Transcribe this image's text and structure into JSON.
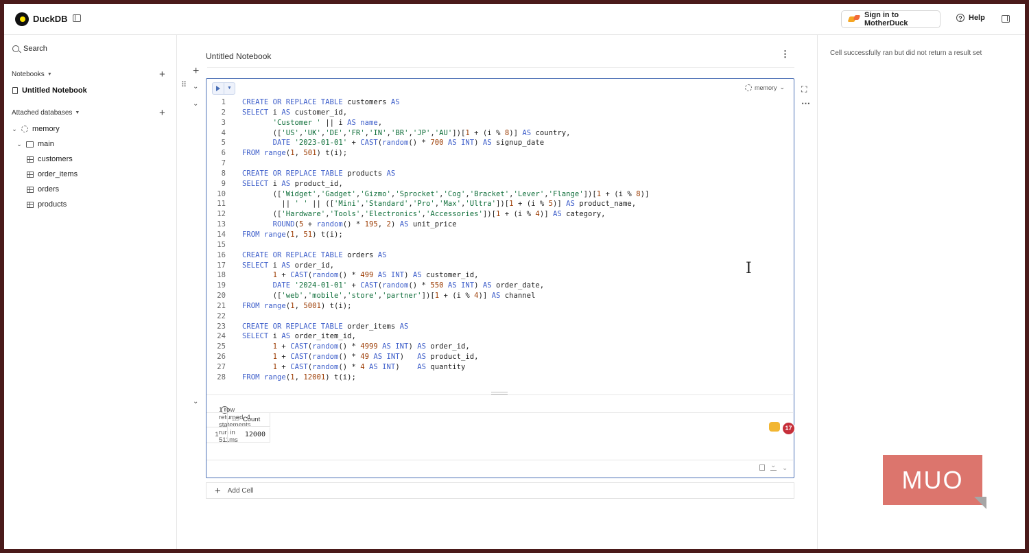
{
  "app": {
    "name": "DuckDB",
    "signin": "Sign in to MotherDuck",
    "help": "Help"
  },
  "sidebar": {
    "search": "Search",
    "notebooks_header": "Notebooks",
    "notebook": "Untitled Notebook",
    "attached_header": "Attached databases",
    "database": "memory",
    "schema": "main",
    "tables": [
      "customers",
      "order_items",
      "orders",
      "products"
    ]
  },
  "notebook": {
    "title": "Untitled Notebook",
    "db_selector": "memory",
    "lines": [
      [
        [
          "kw",
          "CREATE OR REPLACE TABLE "
        ],
        [
          "tx",
          "customers "
        ],
        [
          "kw",
          "AS"
        ]
      ],
      [
        [
          "kw",
          "SELECT "
        ],
        [
          "tx",
          "i "
        ],
        [
          "kw",
          "AS "
        ],
        [
          "tx",
          "customer_id,"
        ]
      ],
      [
        [
          "tx",
          "       "
        ],
        [
          "str",
          "'Customer '"
        ],
        [
          "tx",
          " || i "
        ],
        [
          "kw",
          "AS "
        ],
        [
          "kw",
          "name"
        ],
        [
          "tx",
          ","
        ]
      ],
      [
        [
          "tx",
          "       (["
        ],
        [
          "str",
          "'US'"
        ],
        [
          "tx",
          ","
        ],
        [
          "str",
          "'UK'"
        ],
        [
          "tx",
          ","
        ],
        [
          "str",
          "'DE'"
        ],
        [
          "tx",
          ","
        ],
        [
          "str",
          "'FR'"
        ],
        [
          "tx",
          ","
        ],
        [
          "str",
          "'IN'"
        ],
        [
          "tx",
          ","
        ],
        [
          "str",
          "'BR'"
        ],
        [
          "tx",
          ","
        ],
        [
          "str",
          "'JP'"
        ],
        [
          "tx",
          ","
        ],
        [
          "str",
          "'AU'"
        ],
        [
          "tx",
          "])["
        ],
        [
          "num",
          "1"
        ],
        [
          "tx",
          " + (i % "
        ],
        [
          "num",
          "8"
        ],
        [
          "tx",
          ")] "
        ],
        [
          "kw",
          "AS "
        ],
        [
          "tx",
          "country,"
        ]
      ],
      [
        [
          "tx",
          "       "
        ],
        [
          "kw",
          "DATE "
        ],
        [
          "str",
          "'2023-01-01'"
        ],
        [
          "tx",
          " + "
        ],
        [
          "kw",
          "CAST"
        ],
        [
          "tx",
          "("
        ],
        [
          "kw",
          "random"
        ],
        [
          "tx",
          "() * "
        ],
        [
          "num",
          "700"
        ],
        [
          "tx",
          " "
        ],
        [
          "kw",
          "AS INT"
        ],
        [
          "tx",
          ") "
        ],
        [
          "kw",
          "AS "
        ],
        [
          "tx",
          "signup_date"
        ]
      ],
      [
        [
          "kw",
          "FROM "
        ],
        [
          "kw",
          "range"
        ],
        [
          "tx",
          "("
        ],
        [
          "num",
          "1"
        ],
        [
          "tx",
          ", "
        ],
        [
          "num",
          "501"
        ],
        [
          "tx",
          ") t(i);"
        ]
      ],
      [
        [
          "tx",
          " "
        ]
      ],
      [
        [
          "kw",
          "CREATE OR REPLACE TABLE "
        ],
        [
          "tx",
          "products "
        ],
        [
          "kw",
          "AS"
        ]
      ],
      [
        [
          "kw",
          "SELECT "
        ],
        [
          "tx",
          "i "
        ],
        [
          "kw",
          "AS "
        ],
        [
          "tx",
          "product_id,"
        ]
      ],
      [
        [
          "tx",
          "       (["
        ],
        [
          "str",
          "'Widget'"
        ],
        [
          "tx",
          ","
        ],
        [
          "str",
          "'Gadget'"
        ],
        [
          "tx",
          ","
        ],
        [
          "str",
          "'Gizmo'"
        ],
        [
          "tx",
          ","
        ],
        [
          "str",
          "'Sprocket'"
        ],
        [
          "tx",
          ","
        ],
        [
          "str",
          "'Cog'"
        ],
        [
          "tx",
          ","
        ],
        [
          "str",
          "'Bracket'"
        ],
        [
          "tx",
          ","
        ],
        [
          "str",
          "'Lever'"
        ],
        [
          "tx",
          ","
        ],
        [
          "str",
          "'Flange'"
        ],
        [
          "tx",
          "])["
        ],
        [
          "num",
          "1"
        ],
        [
          "tx",
          " + (i % "
        ],
        [
          "num",
          "8"
        ],
        [
          "tx",
          ")]"
        ]
      ],
      [
        [
          "tx",
          "         || "
        ],
        [
          "str",
          "' '"
        ],
        [
          "tx",
          " || (["
        ],
        [
          "str",
          "'Mini'"
        ],
        [
          "tx",
          ","
        ],
        [
          "str",
          "'Standard'"
        ],
        [
          "tx",
          ","
        ],
        [
          "str",
          "'Pro'"
        ],
        [
          "tx",
          ","
        ],
        [
          "str",
          "'Max'"
        ],
        [
          "tx",
          ","
        ],
        [
          "str",
          "'Ultra'"
        ],
        [
          "tx",
          "])["
        ],
        [
          "num",
          "1"
        ],
        [
          "tx",
          " + (i % "
        ],
        [
          "num",
          "5"
        ],
        [
          "tx",
          ")] "
        ],
        [
          "kw",
          "AS "
        ],
        [
          "tx",
          "product_name,"
        ]
      ],
      [
        [
          "tx",
          "       (["
        ],
        [
          "str",
          "'Hardware'"
        ],
        [
          "tx",
          ","
        ],
        [
          "str",
          "'Tools'"
        ],
        [
          "tx",
          ","
        ],
        [
          "str",
          "'Electronics'"
        ],
        [
          "tx",
          ","
        ],
        [
          "str",
          "'Accessories'"
        ],
        [
          "tx",
          "])["
        ],
        [
          "num",
          "1"
        ],
        [
          "tx",
          " + (i % "
        ],
        [
          "num",
          "4"
        ],
        [
          "tx",
          ")] "
        ],
        [
          "kw",
          "AS "
        ],
        [
          "tx",
          "category,"
        ]
      ],
      [
        [
          "tx",
          "       "
        ],
        [
          "kw",
          "ROUND"
        ],
        [
          "tx",
          "("
        ],
        [
          "num",
          "5"
        ],
        [
          "tx",
          " + "
        ],
        [
          "kw",
          "random"
        ],
        [
          "tx",
          "() * "
        ],
        [
          "num",
          "195"
        ],
        [
          "tx",
          ", "
        ],
        [
          "num",
          "2"
        ],
        [
          "tx",
          ") "
        ],
        [
          "kw",
          "AS "
        ],
        [
          "tx",
          "unit_price"
        ]
      ],
      [
        [
          "kw",
          "FROM "
        ],
        [
          "kw",
          "range"
        ],
        [
          "tx",
          "("
        ],
        [
          "num",
          "1"
        ],
        [
          "tx",
          ", "
        ],
        [
          "num",
          "51"
        ],
        [
          "tx",
          ") t(i);"
        ]
      ],
      [
        [
          "tx",
          " "
        ]
      ],
      [
        [
          "kw",
          "CREATE OR REPLACE TABLE "
        ],
        [
          "tx",
          "orders "
        ],
        [
          "kw",
          "AS"
        ]
      ],
      [
        [
          "kw",
          "SELECT "
        ],
        [
          "tx",
          "i "
        ],
        [
          "kw",
          "AS "
        ],
        [
          "tx",
          "order_id,"
        ]
      ],
      [
        [
          "tx",
          "       "
        ],
        [
          "num",
          "1"
        ],
        [
          "tx",
          " + "
        ],
        [
          "kw",
          "CAST"
        ],
        [
          "tx",
          "("
        ],
        [
          "kw",
          "random"
        ],
        [
          "tx",
          "() * "
        ],
        [
          "num",
          "499"
        ],
        [
          "tx",
          " "
        ],
        [
          "kw",
          "AS INT"
        ],
        [
          "tx",
          ") "
        ],
        [
          "kw",
          "AS "
        ],
        [
          "tx",
          "customer_id,"
        ]
      ],
      [
        [
          "tx",
          "       "
        ],
        [
          "kw",
          "DATE "
        ],
        [
          "str",
          "'2024-01-01'"
        ],
        [
          "tx",
          " + "
        ],
        [
          "kw",
          "CAST"
        ],
        [
          "tx",
          "("
        ],
        [
          "kw",
          "random"
        ],
        [
          "tx",
          "() * "
        ],
        [
          "num",
          "550"
        ],
        [
          "tx",
          " "
        ],
        [
          "kw",
          "AS INT"
        ],
        [
          "tx",
          ") "
        ],
        [
          "kw",
          "AS "
        ],
        [
          "tx",
          "order_date,"
        ]
      ],
      [
        [
          "tx",
          "       (["
        ],
        [
          "str",
          "'web'"
        ],
        [
          "tx",
          ","
        ],
        [
          "str",
          "'mobile'"
        ],
        [
          "tx",
          ","
        ],
        [
          "str",
          "'store'"
        ],
        [
          "tx",
          ","
        ],
        [
          "str",
          "'partner'"
        ],
        [
          "tx",
          "])["
        ],
        [
          "num",
          "1"
        ],
        [
          "tx",
          " + (i % "
        ],
        [
          "num",
          "4"
        ],
        [
          "tx",
          ")] "
        ],
        [
          "kw",
          "AS "
        ],
        [
          "tx",
          "channel"
        ]
      ],
      [
        [
          "kw",
          "FROM "
        ],
        [
          "kw",
          "range"
        ],
        [
          "tx",
          "("
        ],
        [
          "num",
          "1"
        ],
        [
          "tx",
          ", "
        ],
        [
          "num",
          "5001"
        ],
        [
          "tx",
          ") t(i);"
        ]
      ],
      [
        [
          "tx",
          " "
        ]
      ],
      [
        [
          "kw",
          "CREATE OR REPLACE TABLE "
        ],
        [
          "tx",
          "order_items "
        ],
        [
          "kw",
          "AS"
        ]
      ],
      [
        [
          "kw",
          "SELECT "
        ],
        [
          "tx",
          "i "
        ],
        [
          "kw",
          "AS "
        ],
        [
          "tx",
          "order_item_id,"
        ]
      ],
      [
        [
          "tx",
          "       "
        ],
        [
          "num",
          "1"
        ],
        [
          "tx",
          " + "
        ],
        [
          "kw",
          "CAST"
        ],
        [
          "tx",
          "("
        ],
        [
          "kw",
          "random"
        ],
        [
          "tx",
          "() * "
        ],
        [
          "num",
          "4999"
        ],
        [
          "tx",
          " "
        ],
        [
          "kw",
          "AS INT"
        ],
        [
          "tx",
          ") "
        ],
        [
          "kw",
          "AS "
        ],
        [
          "tx",
          "order_id,"
        ]
      ],
      [
        [
          "tx",
          "       "
        ],
        [
          "num",
          "1"
        ],
        [
          "tx",
          " + "
        ],
        [
          "kw",
          "CAST"
        ],
        [
          "tx",
          "("
        ],
        [
          "kw",
          "random"
        ],
        [
          "tx",
          "() * "
        ],
        [
          "num",
          "49"
        ],
        [
          "tx",
          " "
        ],
        [
          "kw",
          "AS INT"
        ],
        [
          "tx",
          ")   "
        ],
        [
          "kw",
          "AS "
        ],
        [
          "tx",
          "product_id,"
        ]
      ],
      [
        [
          "tx",
          "       "
        ],
        [
          "num",
          "1"
        ],
        [
          "tx",
          " + "
        ],
        [
          "kw",
          "CAST"
        ],
        [
          "tx",
          "("
        ],
        [
          "kw",
          "random"
        ],
        [
          "tx",
          "() * "
        ],
        [
          "num",
          "4"
        ],
        [
          "tx",
          " "
        ],
        [
          "kw",
          "AS INT"
        ],
        [
          "tx",
          ")    "
        ],
        [
          "kw",
          "AS "
        ],
        [
          "tx",
          "quantity"
        ]
      ],
      [
        [
          "kw",
          "FROM "
        ],
        [
          "kw",
          "range"
        ],
        [
          "tx",
          "("
        ],
        [
          "num",
          "1"
        ],
        [
          "tx",
          ", "
        ],
        [
          "num",
          "12001"
        ],
        [
          "tx",
          ") t(i);"
        ]
      ]
    ],
    "result_summary": "1 row returned, 4 statements run in 511ms",
    "result_column": "Count",
    "result_column_type": "123",
    "result_row_number": "1",
    "result_value": "12000",
    "add_cell": "Add Cell",
    "badge_count": "17"
  },
  "right_panel": {
    "message": "Cell successfully ran but did not return a result set"
  },
  "watermark": "MUO"
}
